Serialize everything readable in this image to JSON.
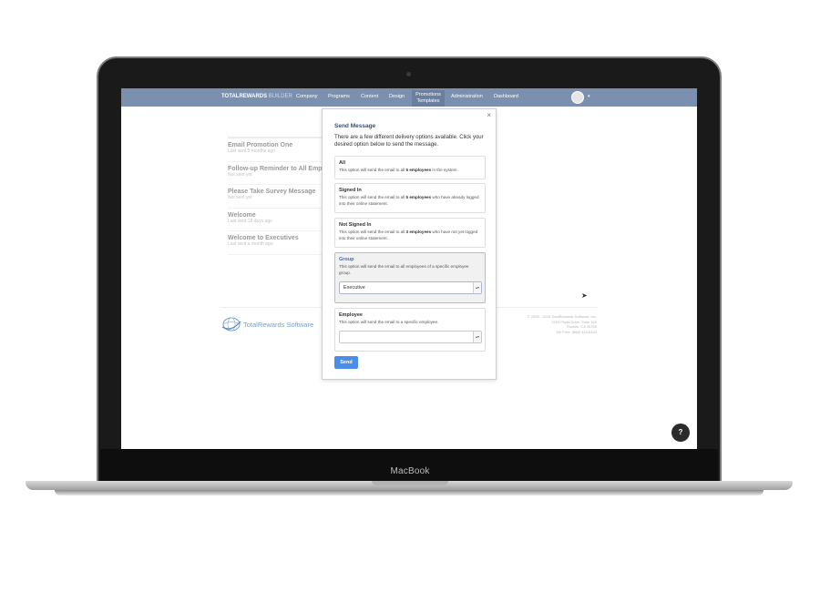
{
  "device": {
    "brand": "MacBook"
  },
  "navbar": {
    "logo_bold": "TOTALREWARDS",
    "logo_light": "BUILDER",
    "items": [
      {
        "label": "Company"
      },
      {
        "label": "Programs"
      },
      {
        "label": "Content"
      },
      {
        "label": "Design"
      },
      {
        "label_line1": "Promotions",
        "label_line2": "Templates"
      },
      {
        "label": "Administration"
      },
      {
        "label": "Dashboard"
      }
    ],
    "avatar_caret": "▾"
  },
  "messages": [
    {
      "title": "Email Promotion One",
      "sub": "Last sent 5 months ago"
    },
    {
      "title": "Follow-up Reminder to All Empl",
      "sub": "Not sent yet"
    },
    {
      "title": "Please Take Survey Message",
      "sub": "Not sent yet"
    },
    {
      "title": "Welcome",
      "sub": "Last sent 18 days ago"
    },
    {
      "title": "Welcome to Executives",
      "sub": "Last sent a month ago"
    }
  ],
  "footer": {
    "logo_text": "TotalRewards Software",
    "line1": "© 2008 - 2015 TotalRewards Software, Inc.",
    "line2": "2209 Plaza Drive, Suite 100",
    "line3": "Rocklin, CA 95765",
    "line4": "Toll Free: (888) 419-6142"
  },
  "modal": {
    "close": "×",
    "title": "Send Message",
    "description": "There are a few different delivery options available. Click your desired option below to send the message.",
    "options": {
      "all": {
        "title": "All",
        "desc_pre": "This option will send the email to all ",
        "desc_bold": "5 employees",
        "desc_post": " in the system."
      },
      "signed_in": {
        "title": "Signed In",
        "desc_pre": "This option will send the email to all ",
        "desc_bold": "5 employees",
        "desc_post": " who have already logged into their online statement."
      },
      "not_signed_in": {
        "title": "Not Signed In",
        "desc_pre": "This option will send the email to all ",
        "desc_bold": "3 employees",
        "desc_post": " who have not yet logged into their online statement."
      },
      "group": {
        "title": "Group",
        "desc": "This option will send the email to all employees of a specific employee group.",
        "selected_value": "Executive"
      },
      "employee": {
        "title": "Employee",
        "desc": "This option will send the email to a specific employee.",
        "selected_value": ""
      }
    },
    "send_label": "Send"
  },
  "help_icon": "?",
  "colors": {
    "navbar": "#7b8faf",
    "accent": "#4a8ee8",
    "modal_title": "#334e86"
  }
}
